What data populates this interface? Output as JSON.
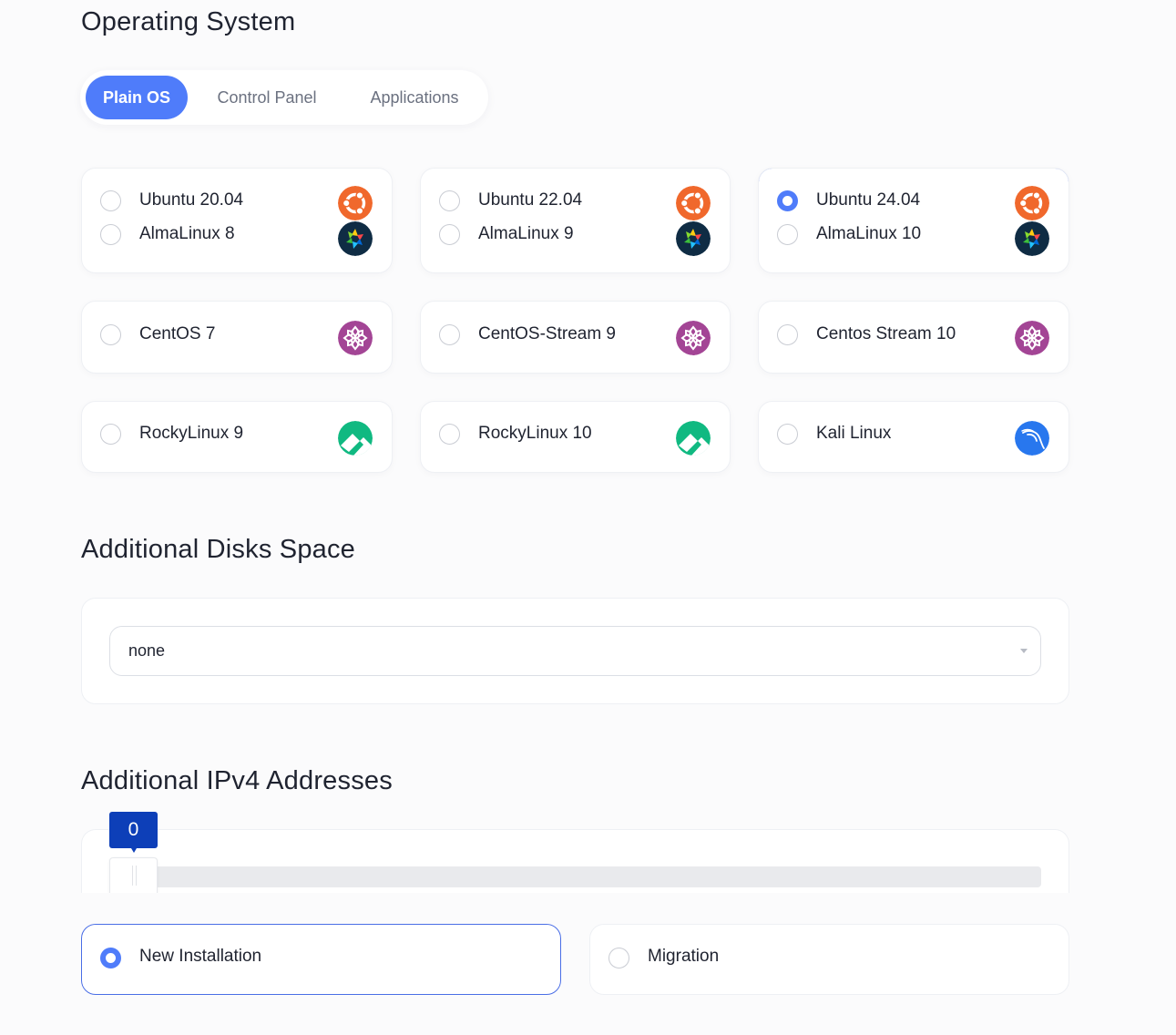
{
  "os_section": {
    "title": "Operating System",
    "tabs": [
      {
        "label": "Plain OS",
        "active": true
      },
      {
        "label": "Control Panel",
        "active": false
      },
      {
        "label": "Applications",
        "active": false
      }
    ],
    "options": [
      {
        "label": "Ubuntu 20.04",
        "icon": "ubuntu-icon",
        "checked": false
      },
      {
        "label": "AlmaLinux 8",
        "icon": "almalinux-icon",
        "checked": false
      },
      {
        "label": "Ubuntu 22.04",
        "icon": "ubuntu-icon",
        "checked": false
      },
      {
        "label": "AlmaLinux 9",
        "icon": "almalinux-icon",
        "checked": false
      },
      {
        "label": "Ubuntu 24.04",
        "icon": "ubuntu-icon",
        "checked": true
      },
      {
        "label": "AlmaLinux 10",
        "icon": "almalinux-icon",
        "checked": false
      },
      {
        "label": "CentOS 7",
        "icon": "centos-icon",
        "checked": false
      },
      {
        "label": "CentOS-Stream 9",
        "icon": "centos-icon",
        "checked": false
      },
      {
        "label": "Centos Stream 10",
        "icon": "centos-icon",
        "checked": false
      },
      {
        "label": "RockyLinux 9",
        "icon": "rocky-icon",
        "checked": false
      },
      {
        "label": "RockyLinux 10",
        "icon": "rocky-icon",
        "checked": false
      },
      {
        "label": "Kali Linux",
        "icon": "kali-icon",
        "checked": false
      }
    ]
  },
  "disks": {
    "title": "Additional Disks Space",
    "selected": "none"
  },
  "ipv4": {
    "title": "Additional IPv4 Addresses",
    "value": "0"
  },
  "install_type": {
    "options": [
      {
        "label": "New Installation",
        "checked": true
      },
      {
        "label": "Migration",
        "checked": false
      }
    ]
  },
  "colors": {
    "accent": "#4f7cfa",
    "tooltip": "#0d3fb8",
    "ubuntu": "#f0682c",
    "almalinux": "#0f2c44",
    "centos": "#a34595",
    "rocky": "#10b981",
    "kali": "#2877ee"
  }
}
